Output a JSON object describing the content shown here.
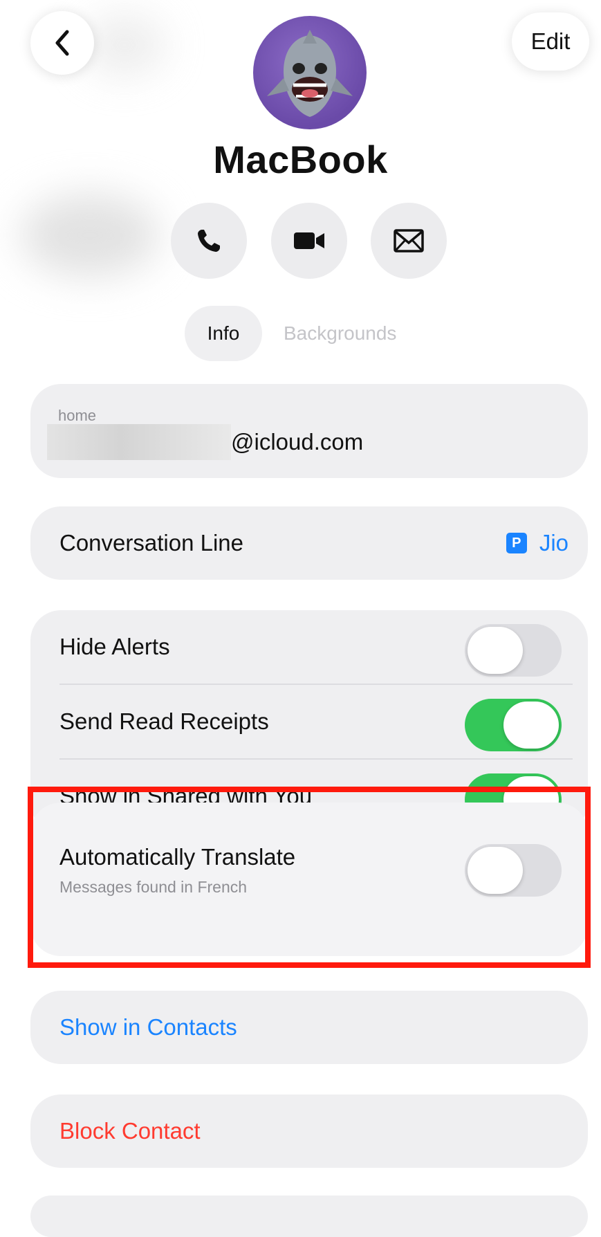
{
  "header": {
    "back_icon": "chevron-left-icon",
    "edit_label": "Edit",
    "contact_name": "MacBook",
    "avatar_icon": "shark-memoji-avatar"
  },
  "actions": [
    {
      "icon": "phone-icon"
    },
    {
      "icon": "video-icon"
    },
    {
      "icon": "mail-icon"
    }
  ],
  "tabs": {
    "info": "Info",
    "backgrounds": "Backgrounds"
  },
  "contact_card": {
    "label": "home",
    "email_suffix": "@icloud.com"
  },
  "conversation_line": {
    "label": "Conversation Line",
    "badge": "P",
    "value": "Jio"
  },
  "settings": {
    "hide_alerts": {
      "label": "Hide Alerts",
      "on": false
    },
    "send_read_receipts": {
      "label": "Send Read Receipts",
      "on": true
    },
    "show_shared": {
      "label": "Show in Shared with You",
      "on": true
    }
  },
  "translate": {
    "label": "Automatically Translate",
    "subtitle": "Messages found in French",
    "on": false
  },
  "links": {
    "show_contacts": "Show in Contacts",
    "block_contact": "Block Contact"
  },
  "colors": {
    "accent": "#1a84ff",
    "destructive": "#ff3b30",
    "toggle_on": "#34c759",
    "highlight": "#ff1a0d"
  }
}
